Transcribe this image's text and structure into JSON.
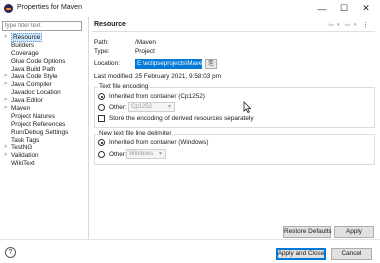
{
  "window": {
    "title": "Properties for Maven",
    "minimize_glyph": "—",
    "maximize_glyph": "☐",
    "close_glyph": "✕"
  },
  "sidebar": {
    "filter_placeholder": "type filter text",
    "items": [
      {
        "label": "Resource",
        "expandable": true,
        "selected": true
      },
      {
        "label": "Builders",
        "expandable": false
      },
      {
        "label": "Coverage",
        "expandable": false
      },
      {
        "label": "Glue Code Options",
        "expandable": false
      },
      {
        "label": "Java Build Path",
        "expandable": false
      },
      {
        "label": "Java Code Style",
        "expandable": true
      },
      {
        "label": "Java Compiler",
        "expandable": true
      },
      {
        "label": "Javadoc Location",
        "expandable": false
      },
      {
        "label": "Java Editor",
        "expandable": true
      },
      {
        "label": "Maven",
        "expandable": true
      },
      {
        "label": "Project Natures",
        "expandable": false
      },
      {
        "label": "Project References",
        "expandable": false
      },
      {
        "label": "Run/Debug Settings",
        "expandable": false
      },
      {
        "label": "Task Tags",
        "expandable": false
      },
      {
        "label": "TestNG",
        "expandable": true
      },
      {
        "label": "Validation",
        "expandable": true
      },
      {
        "label": "WikiText",
        "expandable": false
      }
    ]
  },
  "header": {
    "title": "Resource",
    "nav_back": "⇦",
    "nav_back_menu": "▾",
    "nav_forward": "⇨",
    "nav_forward_menu": "▾",
    "menu": "⋮"
  },
  "resource": {
    "path_label": "Path:",
    "path_value": "/Maven",
    "type_label": "Type:",
    "type_value": "Project",
    "location_label": "Location:",
    "location_value": "E:\\eclipseprojects\\Maven",
    "location_button": "⎘",
    "modified_label": "Last modified:",
    "modified_value": "25 February 2021, 9:58:03 pm"
  },
  "encoding": {
    "group_title": "Text file encoding",
    "inherited_label": "Inherited from container (Cp1252)",
    "other_label": "Other:",
    "other_value": "Cp1252",
    "store_label": "Store the encoding of derived resources separately"
  },
  "delimiter": {
    "group_title": "New text file line delimiter",
    "inherited_label": "Inherited from container (Windows)",
    "other_label": "Other:",
    "other_value": "Windows"
  },
  "buttons": {
    "restore": "Restore Defaults",
    "apply": "Apply",
    "apply_close": "Apply and Close",
    "cancel": "Cancel",
    "help": "?"
  }
}
